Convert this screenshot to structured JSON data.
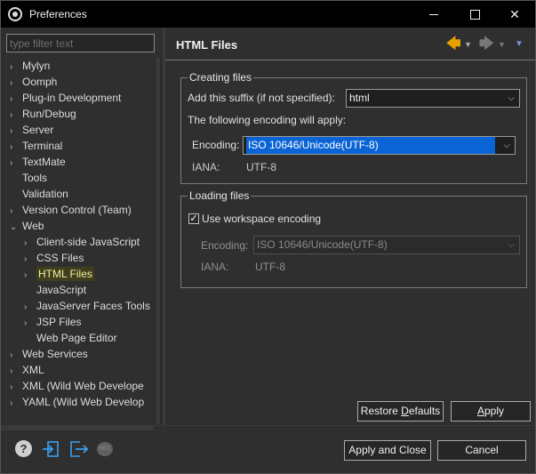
{
  "window": {
    "title": "Preferences"
  },
  "filter": {
    "placeholder": "type filter text"
  },
  "tree": [
    {
      "label": "Mylyn",
      "arrow": "›",
      "indent": 0
    },
    {
      "label": "Oomph",
      "arrow": "›",
      "indent": 0
    },
    {
      "label": "Plug-in Development",
      "arrow": "›",
      "indent": 0
    },
    {
      "label": "Run/Debug",
      "arrow": "›",
      "indent": 0
    },
    {
      "label": "Server",
      "arrow": "›",
      "indent": 0
    },
    {
      "label": "Terminal",
      "arrow": "›",
      "indent": 0
    },
    {
      "label": "TextMate",
      "arrow": "›",
      "indent": 0
    },
    {
      "label": "Tools",
      "arrow": "",
      "indent": 0
    },
    {
      "label": "Validation",
      "arrow": "",
      "indent": 0
    },
    {
      "label": "Version Control (Team)",
      "arrow": "›",
      "indent": 0
    },
    {
      "label": "Web",
      "arrow": "⌄",
      "indent": 0
    },
    {
      "label": "Client-side JavaScript",
      "arrow": "›",
      "indent": 1
    },
    {
      "label": "CSS Files",
      "arrow": "›",
      "indent": 1
    },
    {
      "label": "HTML Files",
      "arrow": "›",
      "indent": 1,
      "selected": true
    },
    {
      "label": "JavaScript",
      "arrow": "",
      "indent": 1
    },
    {
      "label": "JavaServer Faces Tools",
      "arrow": "›",
      "indent": 1
    },
    {
      "label": "JSP Files",
      "arrow": "›",
      "indent": 1
    },
    {
      "label": "Web Page Editor",
      "arrow": "",
      "indent": 1
    },
    {
      "label": "Web Services",
      "arrow": "›",
      "indent": 0
    },
    {
      "label": "XML",
      "arrow": "›",
      "indent": 0
    },
    {
      "label": "XML (Wild Web Develope",
      "arrow": "›",
      "indent": 0
    },
    {
      "label": "YAML (Wild Web Develop",
      "arrow": "›",
      "indent": 0
    }
  ],
  "page": {
    "title": "HTML Files",
    "creating": {
      "legend": "Creating files",
      "suffix_label": "Add this suffix (if not specified):",
      "suffix_value": "html",
      "encoding_note": "The following encoding will apply:",
      "encoding_label": "Encoding:",
      "encoding_value": "ISO 10646/Unicode(UTF-8)",
      "iana_label": "IANA:",
      "iana_value": "UTF-8"
    },
    "loading": {
      "legend": "Loading files",
      "workspace_label": "Use workspace encoding",
      "workspace_checked": true,
      "encoding_label": "Encoding:",
      "encoding_value": "ISO 10646/Unicode(UTF-8)",
      "iana_label": "IANA:",
      "iana_value": "UTF-8"
    },
    "restore_defaults_pre": "Restore ",
    "restore_defaults_u": "D",
    "restore_defaults_post": "efaults",
    "apply_pre": "",
    "apply_u": "A",
    "apply_post": "pply"
  },
  "footer": {
    "apply_close": "Apply and Close",
    "cancel": "Cancel",
    "help_glyph": "?",
    "oomph_glyph": "REC"
  },
  "icons": {
    "back": "back-arrow-icon",
    "forward": "forward-arrow-icon",
    "menu": "view-menu-icon",
    "help": "help-icon",
    "import": "import-icon",
    "export": "export-icon",
    "oomph": "oomph-record-icon"
  },
  "colors": {
    "accent_back": "#e8a000",
    "selection": "#0a64d6",
    "tree_selected_text": "#f0f0a0",
    "link_icons": "#3a9ff0"
  }
}
